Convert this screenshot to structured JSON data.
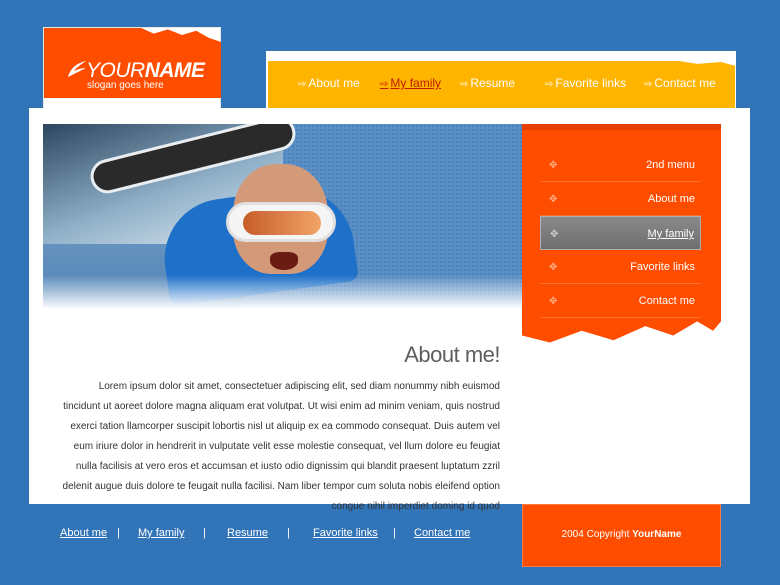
{
  "logo": {
    "name_light": "YOUR",
    "name_bold": "NAME",
    "slogan": "slogan goes here"
  },
  "topnav": {
    "items": [
      {
        "label": "About me",
        "active": false
      },
      {
        "label": "My family",
        "active": true
      },
      {
        "label": "Resume",
        "active": false
      },
      {
        "label": "Favorite links",
        "active": false
      },
      {
        "label": "Contact me",
        "active": false
      }
    ]
  },
  "sidemenu": {
    "items": [
      {
        "label": "2nd menu",
        "active": false
      },
      {
        "label": "About me",
        "active": false
      },
      {
        "label": "My family",
        "active": true
      },
      {
        "label": "Favorite links",
        "active": false
      },
      {
        "label": "Contact me",
        "active": false
      }
    ]
  },
  "content": {
    "heading": "About me!",
    "body": "Lorem ipsum dolor sit amet, consectetuer adipiscing elit, sed diam nonummy nibh euismod tincidunt ut aoreet dolore magna aliquam erat volutpat. Ut wisi enim ad minim veniam, quis nostrud exerci tation llamcorper suscipit lobortis nisl ut aliquip ex ea commodo consequat. Duis autem vel eum iriure dolor in hendrerit in vulputate velit esse molestie consequat, vel llum dolore eu feugiat nulla facilisis at vero eros et accumsan et iusto odio dignissim qui blandit praesent luptatum zzril delenit augue duis dolore te feugait nulla facilisi. Nam liber tempor cum soluta nobis eleifend option congue nihil imperdiet doming id quod"
  },
  "footer": {
    "links": [
      "About me",
      "My family",
      "Resume",
      "Favorite links",
      "Contact me"
    ],
    "separator": "|",
    "copyright_prefix": "2004 Copyright",
    "copyright_name": "YourName"
  },
  "colors": {
    "background": "#3274b8",
    "orange": "#ff4d00",
    "yellow": "#ffb400"
  }
}
